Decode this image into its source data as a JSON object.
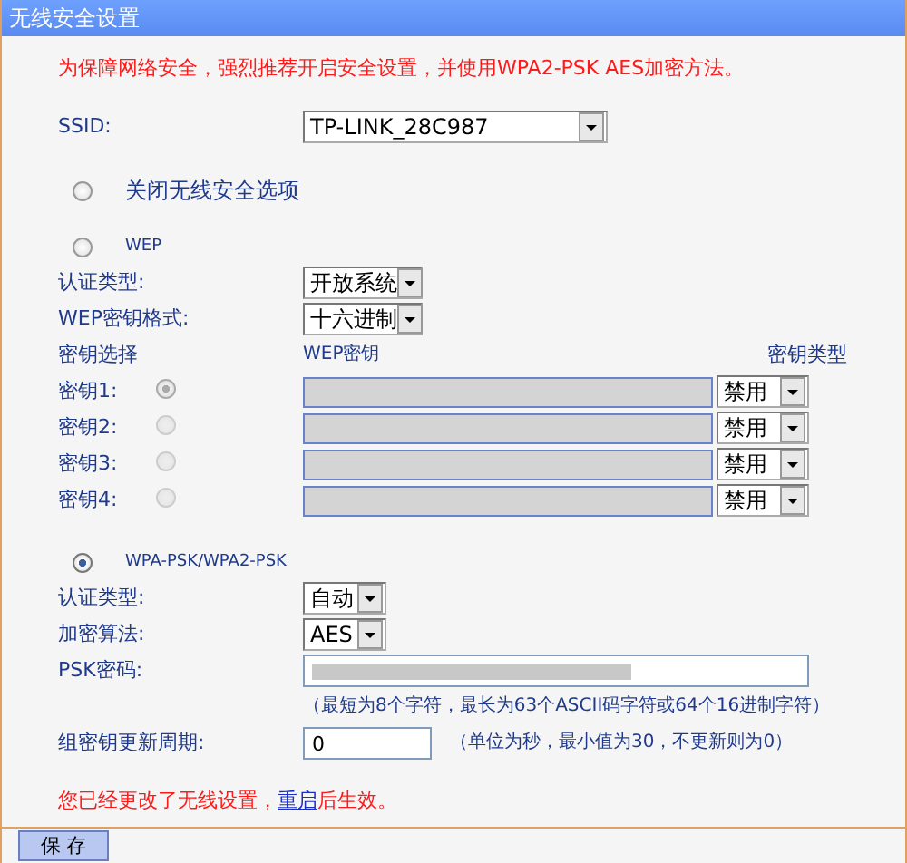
{
  "window": {
    "title": "无线安全设置"
  },
  "warning": "为保障网络安全，强烈推荐开启安全设置，并使用WPA2-PSK AES加密方法。",
  "ssid": {
    "label": "SSID:",
    "value": "TP-LINK_28C987"
  },
  "security_modes": [
    {
      "kind": "none",
      "label": "关闭无线安全选项",
      "selected": false
    },
    {
      "kind": "wep",
      "label": "WEP",
      "selected": false
    },
    {
      "kind": "wpa",
      "label": "WPA-PSK/WPA2-PSK",
      "selected": true
    }
  ],
  "wep": {
    "auth_type": {
      "label": "认证类型:",
      "value": "开放系统"
    },
    "key_format": {
      "label": "WEP密钥格式:",
      "value": "十六进制"
    },
    "key_headers": [
      "密钥选择",
      "WEP密钥",
      "密钥类型"
    ],
    "keys": [
      {
        "label": "密钥1:",
        "selected": true,
        "disabled": true,
        "type": "禁用"
      },
      {
        "label": "密钥2:",
        "selected": false,
        "disabled": true,
        "type": "禁用"
      },
      {
        "label": "密钥3:",
        "selected": false,
        "disabled": true,
        "type": "禁用"
      },
      {
        "label": "密钥4:",
        "selected": false,
        "disabled": true,
        "type": "禁用"
      }
    ]
  },
  "wpa": {
    "auth_type": {
      "label": "认证类型:",
      "value": "自动"
    },
    "encryption": {
      "label": "加密算法:",
      "value": "AES"
    },
    "psk": {
      "label": "PSK密码:",
      "hint": "（最短为8个字符，最长为63个ASCII码字符或64个16进制字符）"
    },
    "group_key": {
      "label": "组密钥更新周期:",
      "value": "0",
      "hint": "（单位为秒，最小值为30，不更新则为0）"
    }
  },
  "notice": {
    "text": "您已经更改了无线设置，",
    "link": "重启",
    "after": "后生效。"
  },
  "save_button": "保 存"
}
